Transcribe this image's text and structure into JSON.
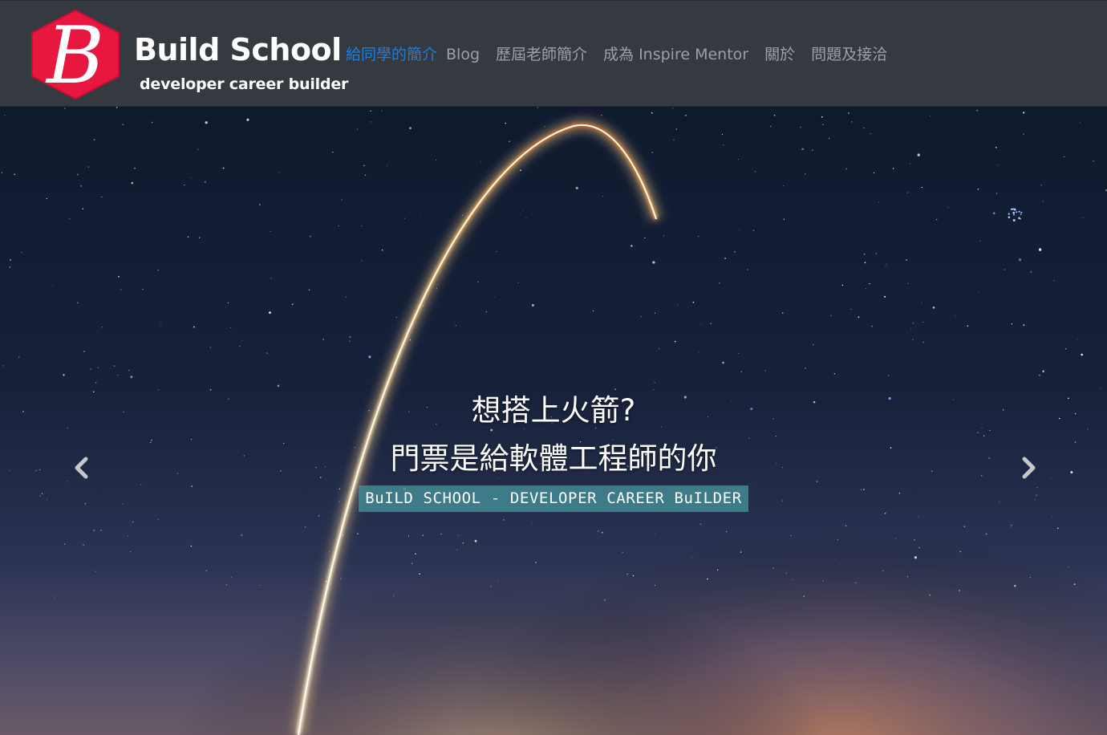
{
  "brand": {
    "logo_letter": "B",
    "title": "Build School",
    "tagline": "developer career builder",
    "logo_color": "#e8173f"
  },
  "nav": {
    "items": [
      {
        "label": "給同學的簡介",
        "active": true
      },
      {
        "label": "Blog",
        "active": false
      },
      {
        "label": "歷屆老師簡介",
        "active": false
      },
      {
        "label": "成為 Inspire Mentor",
        "active": false
      },
      {
        "label": "關於",
        "active": false
      },
      {
        "label": "問題及接洽",
        "active": false
      }
    ],
    "active_color": "#1e7be0",
    "inactive_color": "#9aa0a6"
  },
  "hero": {
    "caption_line1": "想搭上火箭?",
    "caption_line2": "門票是給軟體工程師的你",
    "badge_text": "BuILD SCHOOL - DEVELOPER CAREER BuILDER",
    "prev_icon": "chevron-left-icon",
    "next_icon": "chevron-right-icon"
  }
}
